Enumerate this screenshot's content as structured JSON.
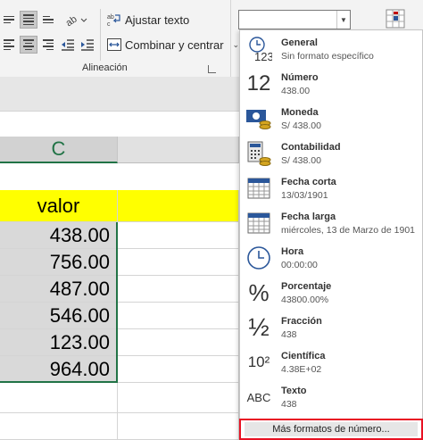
{
  "ribbon": {
    "wrap_text": "Ajustar texto",
    "merge_center": "Combinar y centrar",
    "group_alignment": "Alineación",
    "number_format_value": ""
  },
  "sheet": {
    "column_header": "C",
    "header_cell": "valor",
    "values": [
      "438.00",
      "756.00",
      "487.00",
      "546.00",
      "123.00",
      "964.00"
    ]
  },
  "menu": {
    "items": [
      {
        "name": "General",
        "sample": "Sin formato específico",
        "icon": "clock-123-icon"
      },
      {
        "name": "Número",
        "sample": "438.00",
        "icon": "number-12-icon"
      },
      {
        "name": "Moneda",
        "sample": "S/ 438.00",
        "icon": "currency-icon"
      },
      {
        "name": "Contabilidad",
        "sample": " S/ 438.00",
        "icon": "accounting-icon"
      },
      {
        "name": "Fecha corta",
        "sample": "13/03/1901",
        "icon": "calendar-icon"
      },
      {
        "name": "Fecha larga",
        "sample": "miércoles, 13 de Marzo de 1901",
        "icon": "calendar-icon"
      },
      {
        "name": "Hora",
        "sample": "00:00:00",
        "icon": "clock-icon"
      },
      {
        "name": "Porcentaje",
        "sample": "43800.00%",
        "icon": "percent-icon"
      },
      {
        "name": "Fracción",
        "sample": "438",
        "icon": "fraction-icon"
      },
      {
        "name": "Científica",
        "sample": "4.38E+02",
        "icon": "scientific-icon"
      },
      {
        "name": "Texto",
        "sample": "438",
        "icon": "text-abc-icon"
      }
    ],
    "more_formats": "Más formatos de número...",
    "glyphs": {
      "n12": "12",
      "percent": "%",
      "half": "½",
      "sci": "10²",
      "abc": "ABC",
      "n123": "123"
    }
  },
  "colors": {
    "accent": "#217346",
    "highlight": "#ffff00",
    "outline": "#e81123"
  }
}
